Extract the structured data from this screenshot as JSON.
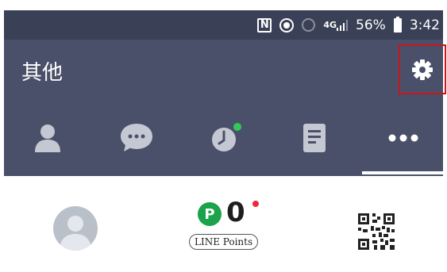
{
  "status_bar": {
    "nfc_glyph": "N",
    "network_label": "4G",
    "battery_percent": "56%",
    "time": "3:42"
  },
  "header": {
    "title": "其他",
    "settings_icon": "gear-icon",
    "settings_highlight_color": "#c9161d"
  },
  "tabs": [
    {
      "icon": "friends-icon",
      "active": false
    },
    {
      "icon": "chats-icon",
      "active": false
    },
    {
      "icon": "timeline-icon",
      "active": false,
      "badge": true
    },
    {
      "icon": "news-icon",
      "active": false
    },
    {
      "icon": "more-icon",
      "active": true
    }
  ],
  "content": {
    "avatar_icon": "profile-avatar",
    "points_badge_letter": "P",
    "points_value": "0",
    "points_label": "LINE Points",
    "qr_icon": "qr-code-icon"
  },
  "colors": {
    "status_bar": "#3a4055",
    "header": "#4a5069",
    "points_green": "#1aa34a",
    "badge_green": "#2ecc55",
    "alert_red": "#ea2b3a"
  }
}
